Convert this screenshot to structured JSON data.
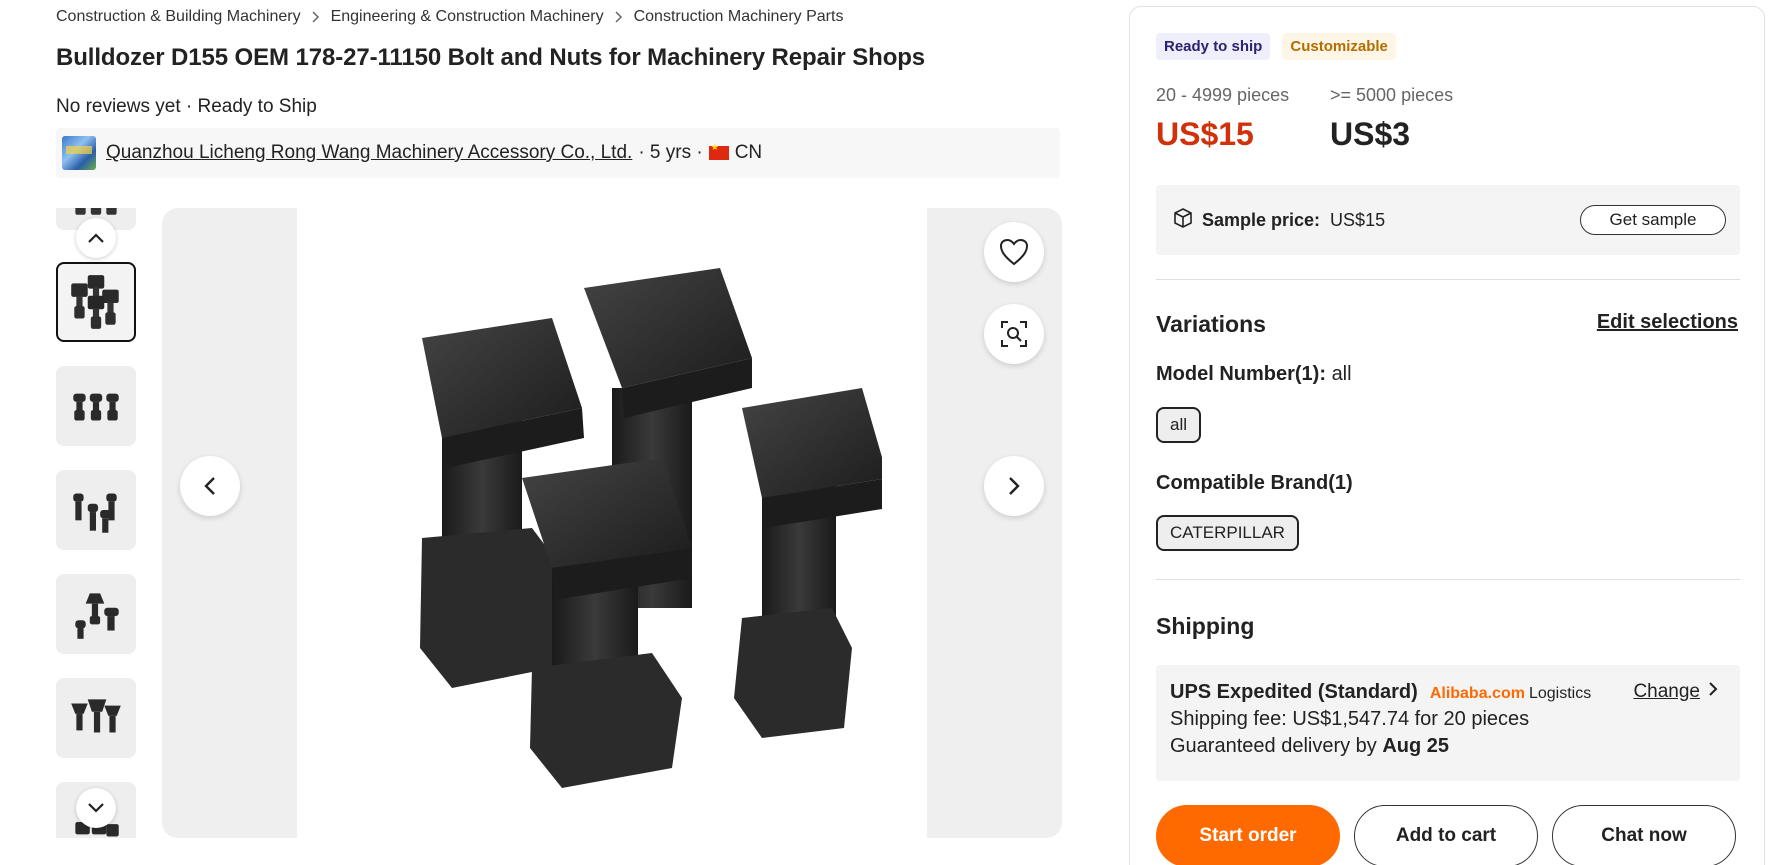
{
  "breadcrumb": [
    "Construction & Building Machinery",
    "Engineering & Construction Machinery",
    "Construction Machinery Parts"
  ],
  "title": "Bulldozer D155 OEM 178-27-11150 Bolt and Nuts for Machinery Repair Shops",
  "reviews_line": "No reviews yet · Ready to Ship",
  "supplier": {
    "name": "Quanzhou Licheng Rong Wang Machinery Accessory Co., Ltd.",
    "years": "· 5 yrs ·",
    "country": "CN"
  },
  "badges": {
    "ready": "Ready to ship",
    "custom": "Customizable"
  },
  "pricing": [
    {
      "range": "20 - 4999 pieces",
      "price": "US$15"
    },
    {
      "range": ">= 5000 pieces",
      "price": "US$3"
    }
  ],
  "sample": {
    "label": "Sample price:",
    "value": "US$15",
    "button": "Get sample"
  },
  "variations": {
    "heading": "Variations",
    "edit": "Edit selections",
    "model_label": "Model Number(1):",
    "model_value": "all",
    "model_chip": "all",
    "brand_label": "Compatible Brand(1)",
    "brand_chip": "CATERPILLAR"
  },
  "shipping": {
    "heading": "Shipping",
    "method": "UPS Expedited (Standard)",
    "brand": "Alibaba.com",
    "logistics": "Logistics",
    "change": "Change",
    "fee": "Shipping fee: US$1,547.74 for 20 pieces",
    "delivery_prefix": "Guaranteed delivery by",
    "delivery_date": "Aug 25"
  },
  "actions": {
    "start": "Start order",
    "cart": "Add to cart",
    "chat": "Chat now"
  },
  "colors": {
    "accent": "#ff6a00",
    "price": "#d0310b",
    "ship_badge_bg": "#efeefb",
    "custom_badge_text": "#b26f00"
  },
  "icons": [
    "chevron-right-icon",
    "chevron-up-icon",
    "chevron-down-icon",
    "chevron-left-icon",
    "heart-icon",
    "image-search-icon",
    "package-icon"
  ]
}
